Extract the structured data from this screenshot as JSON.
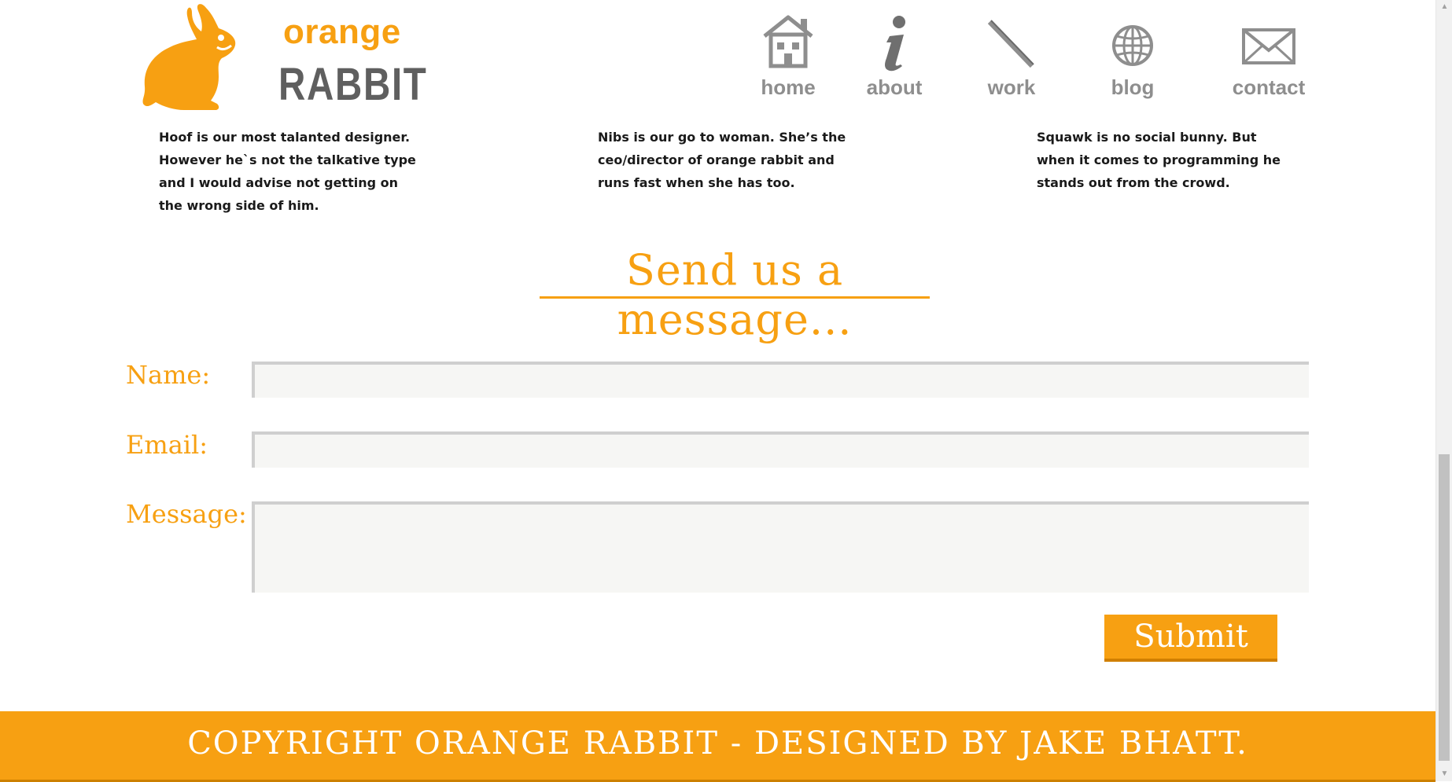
{
  "logo": {
    "word1": "orange",
    "word2": "RABBIT"
  },
  "nav": {
    "items": [
      {
        "label": "home",
        "icon": "house-icon"
      },
      {
        "label": "about",
        "icon": "info-icon"
      },
      {
        "label": "work",
        "icon": "pencil-icon"
      },
      {
        "label": "blog",
        "icon": "globe-icon"
      },
      {
        "label": "contact",
        "icon": "envelope-icon"
      }
    ]
  },
  "team": {
    "bios": [
      "Hoof is our most talanted designer. However he`s not the talkative type and I would advise not getting on the wrong side of him.",
      "Nibs is our go to woman. She’s the ceo/director of orange rabbit and runs fast when she has too.",
      "Squawk is no social bunny. But when it comes to programming he stands out from the crowd."
    ]
  },
  "form": {
    "title": "Send us a message...",
    "name_label": "Name:",
    "email_label": "Email:",
    "message_label": "Message:",
    "name_value": "",
    "email_value": "",
    "message_value": "",
    "submit_label": "Submit"
  },
  "footer": {
    "text": "COPYRIGHT ORANGE RABBIT - DESIGNED BY JAKE BHATT."
  },
  "colors": {
    "accent": "#f7a012",
    "nav_gray": "#8e8e8e",
    "field_bg": "#f6f6f4"
  }
}
